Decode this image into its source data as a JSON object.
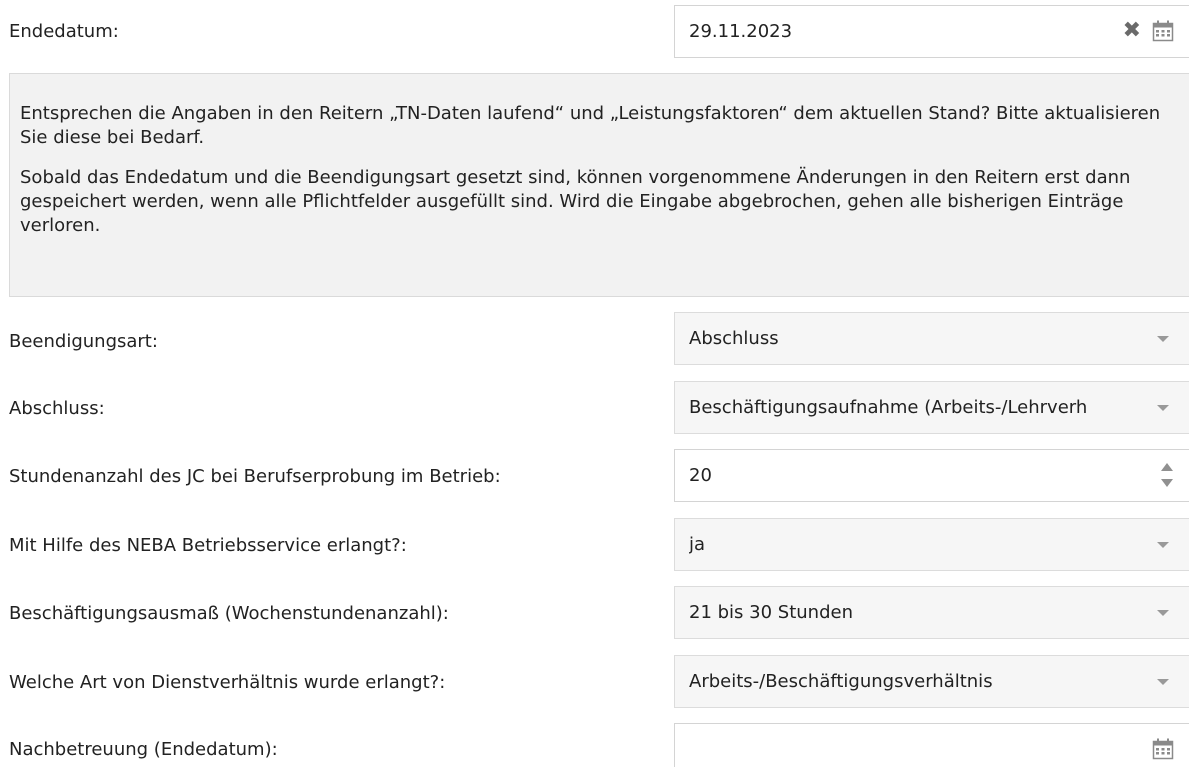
{
  "colors": {
    "select_bg": "#f6f6f6",
    "info_bg": "#f2f2f2",
    "border": "#d4d4d4",
    "caret": "#999999"
  },
  "end_date": {
    "label": "Endedatum:",
    "value": "29.11.2023",
    "clear_icon": "clear-x-icon",
    "calendar_icon": "calendar-icon"
  },
  "info": {
    "paragraph1": "Entsprechen die Angaben in den Reitern „TN-Daten laufend“ und „Leistungsfaktoren“ dem aktuellen Stand? Bitte aktualisieren Sie diese bei Bedarf.",
    "paragraph2": "Sobald das Endedatum und die Beendigungsart gesetzt sind, können vorgenommene Änderungen in den Reitern erst dann gespeichert werden, wenn alle Pflichtfelder ausgefüllt sind. Wird die Eingabe abgebrochen, gehen alle bisherigen Einträge verloren."
  },
  "fields": {
    "beendigungsart": {
      "label": "Beendigungsart:",
      "value": "Abschluss"
    },
    "abschluss": {
      "label": "Abschluss:",
      "value": "Beschäftigungsaufnahme (Arbeits-/Lehrverh"
    },
    "stundenanzahl": {
      "label": "Stundenanzahl des JC bei Berufserprobung im Betrieb:",
      "value": "20"
    },
    "neba": {
      "label": "Mit Hilfe des NEBA Betriebsservice erlangt?:",
      "value": "ja"
    },
    "ausmass": {
      "label": "Beschäftigungsausmaß (Wochenstundenanzahl):",
      "value": "21 bis 30 Stunden"
    },
    "dienstverhaeltnis": {
      "label": "Welche Art von Dienstverhältnis wurde erlangt?:",
      "value": "Arbeits-/Beschäftigungsverhältnis"
    },
    "nachbetreuung": {
      "label": "Nachbetreuung (Endedatum):",
      "value": ""
    }
  }
}
